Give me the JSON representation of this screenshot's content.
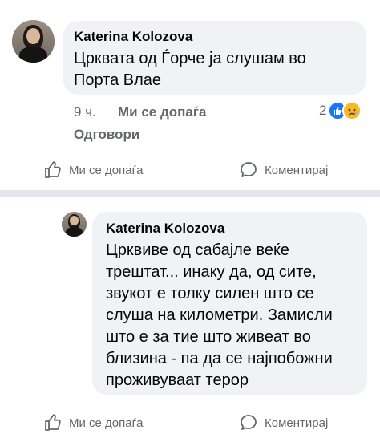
{
  "comment1": {
    "author": "Katerina Kolozova",
    "text_line1": "Црквата од Ѓорче ја слушам во",
    "text_line2": "Порта Влае",
    "time": "9 ч.",
    "like_label": "Ми се допаѓа",
    "reply_label": "Одговори",
    "reaction_count": "2",
    "reaction_icons": [
      "like-icon",
      "sad-icon"
    ]
  },
  "post_actions_1": {
    "like_label": "Ми се допаѓа",
    "comment_label": "Коментирај"
  },
  "comment2": {
    "author": "Katerina Kolozova",
    "lines": [
      "Црквиве од сабајле веќе",
      "трештат... инаку да, од сите,",
      "звукот е толку силен што се",
      "слуша на километри. Замисли",
      "што е за тие што живеат во",
      "близина - па да се најпобожни",
      "проживуваат терор"
    ]
  },
  "post_actions_2": {
    "like_label": "Ми се допаѓа",
    "comment_label": "Коментирај"
  },
  "colors": {
    "bubble": "#f0f2f5",
    "secondary_text": "#65676b",
    "like_blue": "#1877f2",
    "sad_yellow": "#f7b928"
  }
}
